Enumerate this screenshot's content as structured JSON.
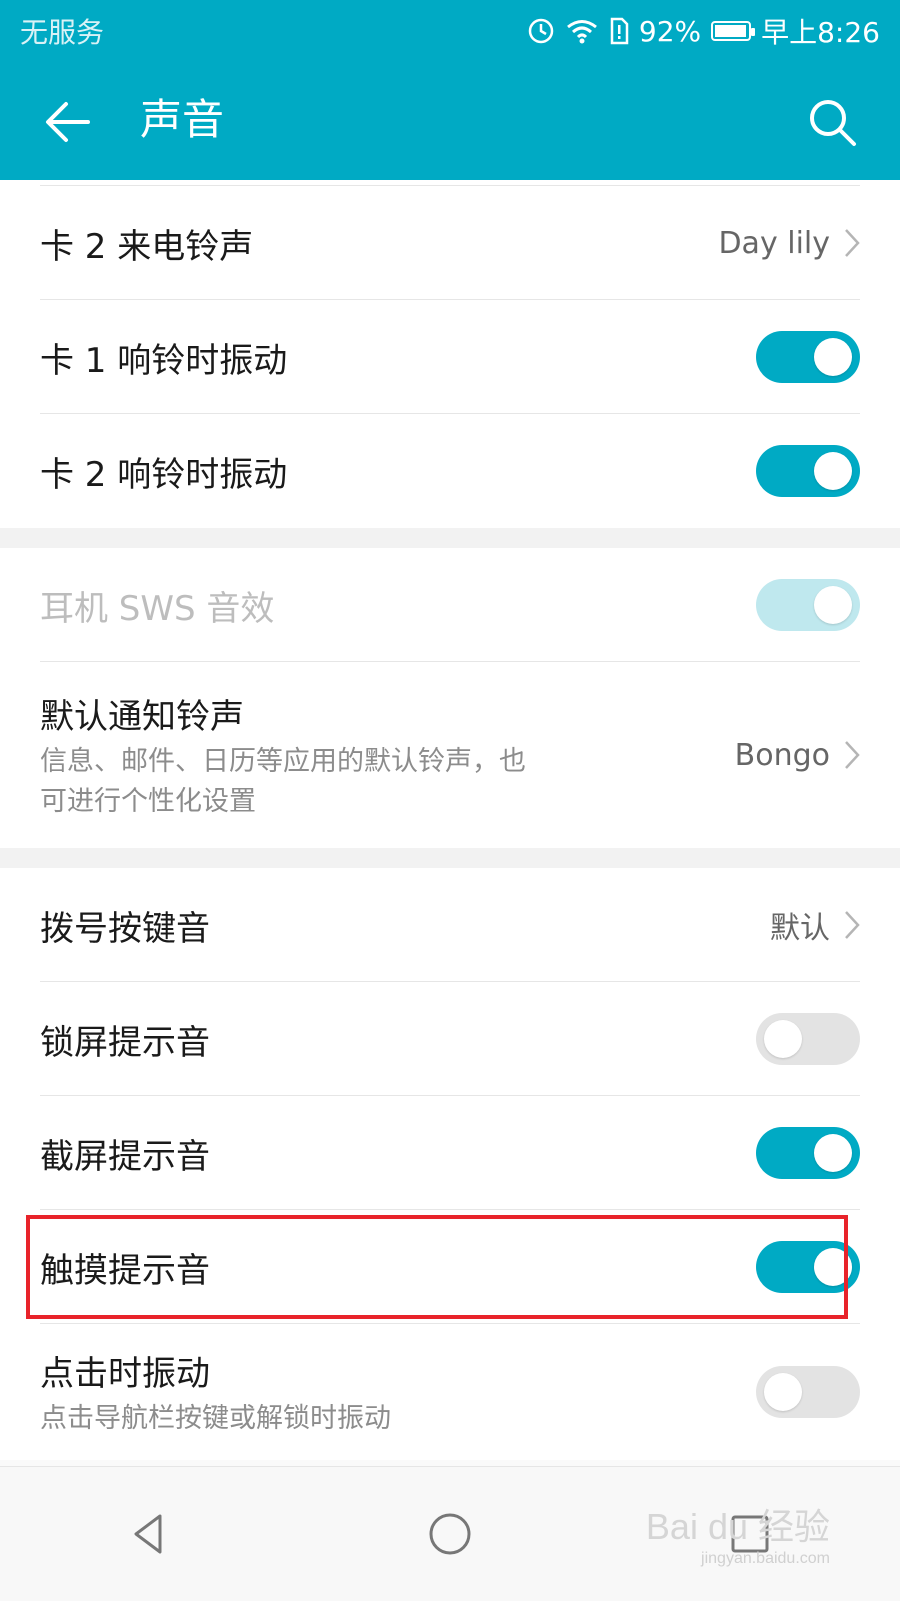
{
  "status_bar": {
    "carrier": "无服务",
    "battery_percent": "92%",
    "time": "早上8:26"
  },
  "app_bar": {
    "title": "声音"
  },
  "settings": {
    "card2_ringtone": {
      "label": "卡 2 来电铃声",
      "value": "Day lily"
    },
    "card1_vibrate": {
      "label": "卡 1 响铃时振动",
      "state": "on"
    },
    "card2_vibrate": {
      "label": "卡 2 响铃时振动",
      "state": "on"
    },
    "headset_sws": {
      "label": "耳机 SWS 音效",
      "state": "disabled-on"
    },
    "default_notification": {
      "label": "默认通知铃声",
      "subtitle": "信息、邮件、日历等应用的默认铃声，也可进行个性化设置",
      "value": "Bongo"
    },
    "dial_keypad_tone": {
      "label": "拨号按键音",
      "value": "默认"
    },
    "lock_screen_sound": {
      "label": "锁屏提示音",
      "state": "off"
    },
    "screenshot_sound": {
      "label": "截屏提示音",
      "state": "on"
    },
    "touch_sound": {
      "label": "触摸提示音",
      "state": "on"
    },
    "vibrate_on_touch": {
      "label": "点击时振动",
      "subtitle": "点击导航栏按键或解锁时振动",
      "state": "off"
    }
  },
  "watermark": {
    "brand": "Bai du 经验",
    "url": "jingyan.baidu.com"
  },
  "colors": {
    "accent": "#00aac4",
    "highlight": "#e8232a"
  }
}
